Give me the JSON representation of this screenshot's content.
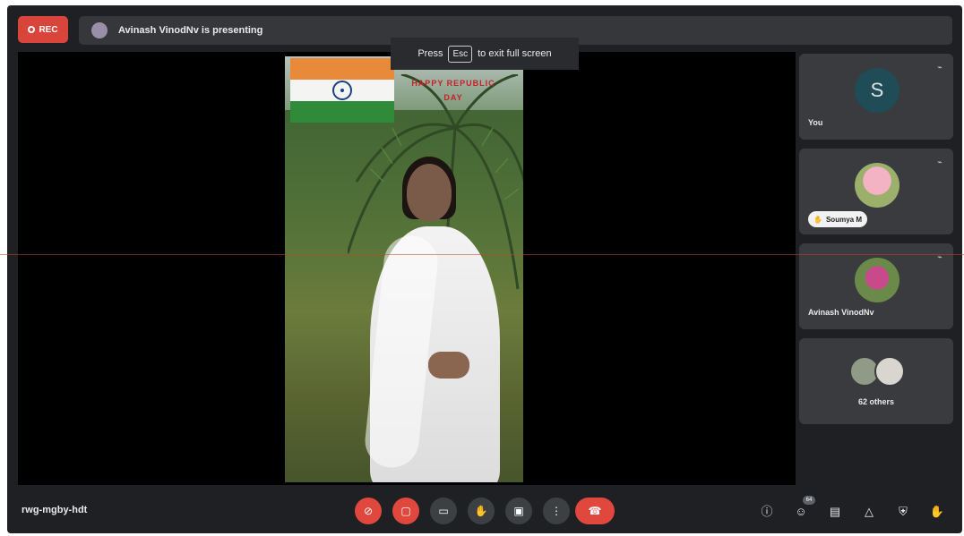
{
  "recording": {
    "label": "REC"
  },
  "presenting": {
    "text": "Avinash VinodNv is presenting"
  },
  "toast": {
    "press": "Press",
    "key": "Esc",
    "rest": "to exit full screen"
  },
  "video": {
    "greeting_line1": "HAPPY REPUBLIC",
    "greeting_line2": "DAY"
  },
  "participants": [
    {
      "name": "You",
      "initial": "S",
      "avatar_color": "#1f4c56"
    },
    {
      "name": "Soumya M",
      "speaking": true
    },
    {
      "name": "Avinash VinodNv"
    },
    {
      "name": "62 others"
    }
  ],
  "meeting_code": "rwg-mgby-hdt",
  "participant_count": "64",
  "controls": [
    {
      "icon": "mic-off-icon",
      "state": "off"
    },
    {
      "icon": "camera-off-icon",
      "state": "off"
    },
    {
      "icon": "captions-icon"
    },
    {
      "icon": "raise-hand-icon"
    },
    {
      "icon": "present-screen-icon"
    },
    {
      "icon": "more-options-icon"
    },
    {
      "icon": "end-call-icon"
    }
  ],
  "right_controls": [
    "info-icon",
    "people-icon",
    "chat-icon",
    "activities-icon",
    "host-controls-icon",
    "hand-raised-indicator-icon"
  ],
  "colors": {
    "accent_red": "#e0473d",
    "background": "#1f2023",
    "tile": "#3a3b3e"
  }
}
